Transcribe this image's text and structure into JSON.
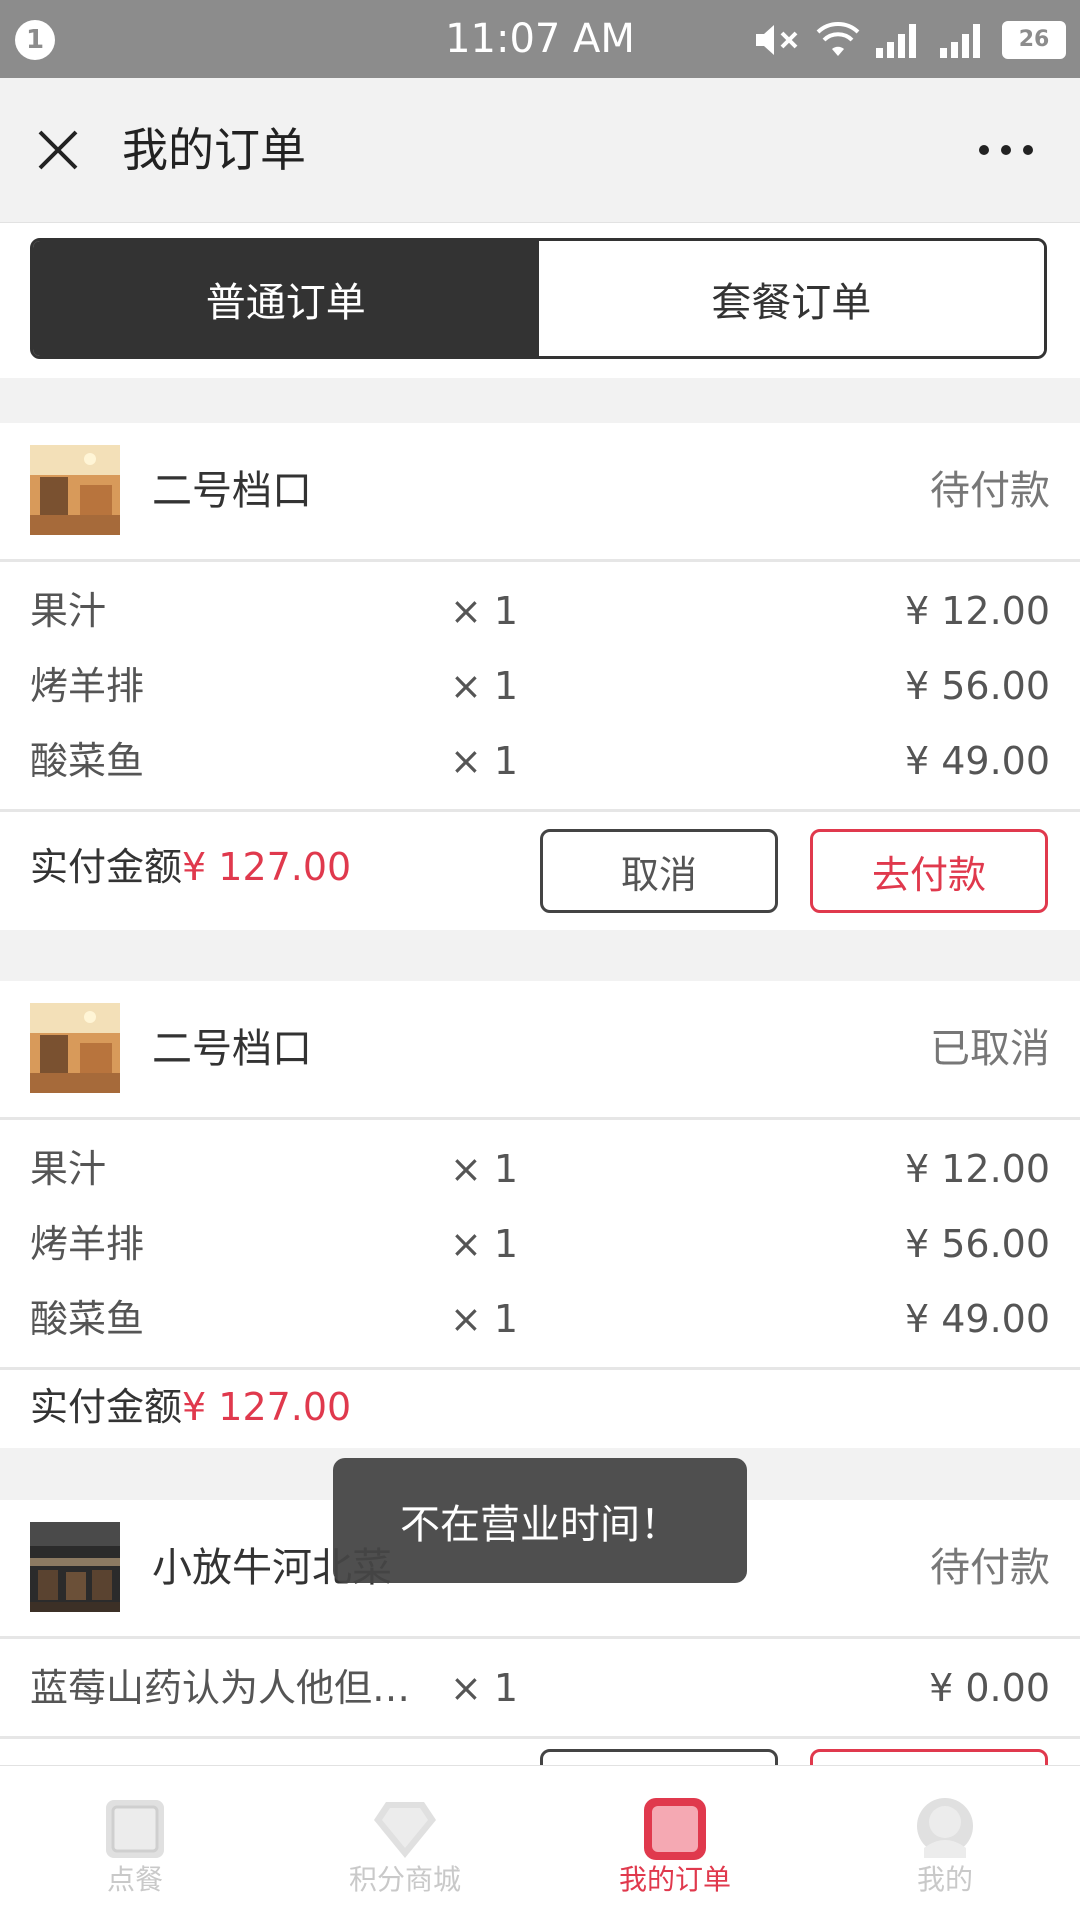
{
  "status_bar": {
    "notification_count": "1",
    "time": "11:07 AM",
    "battery": "26"
  },
  "header": {
    "title": "我的订单"
  },
  "tabs": [
    {
      "label": "普通订单",
      "active": true
    },
    {
      "label": "套餐订单",
      "active": false
    }
  ],
  "orders": [
    {
      "store": "二号档口",
      "status": "待付款",
      "items": [
        {
          "name": "果汁",
          "qty": "× 1",
          "price": "¥ 12.00"
        },
        {
          "name": "烤羊排",
          "qty": "× 1",
          "price": "¥ 56.00"
        },
        {
          "name": "酸菜鱼",
          "qty": "× 1",
          "price": "¥ 49.00"
        }
      ],
      "total_label": "实付金额",
      "total_amount": "¥ 127.00",
      "cancel_label": "取消",
      "pay_label": "去付款"
    },
    {
      "store": "二号档口",
      "status": "已取消",
      "items": [
        {
          "name": "果汁",
          "qty": "× 1",
          "price": "¥ 12.00"
        },
        {
          "name": "烤羊排",
          "qty": "× 1",
          "price": "¥ 56.00"
        },
        {
          "name": "酸菜鱼",
          "qty": "× 1",
          "price": "¥ 49.00"
        }
      ],
      "total_label": "实付金额",
      "total_amount": "¥ 127.00"
    },
    {
      "store": "小放牛河北菜",
      "status": "待付款",
      "items": [
        {
          "name": "蓝莓山药认为人他但…",
          "qty": "× 1",
          "price": "¥ 0.00"
        }
      ]
    }
  ],
  "toast": "不在营业时间！",
  "bottom_nav": [
    {
      "label": "点餐",
      "icon": "order-food-icon",
      "active": false
    },
    {
      "label": "积分商城",
      "icon": "diamond-icon",
      "active": false
    },
    {
      "label": "我的订单",
      "icon": "orders-icon",
      "active": true
    },
    {
      "label": "我的",
      "icon": "profile-icon",
      "active": false
    }
  ],
  "colors": {
    "accent": "#e0394d",
    "dark": "#333333",
    "status_bar": "#8c8c8c"
  }
}
